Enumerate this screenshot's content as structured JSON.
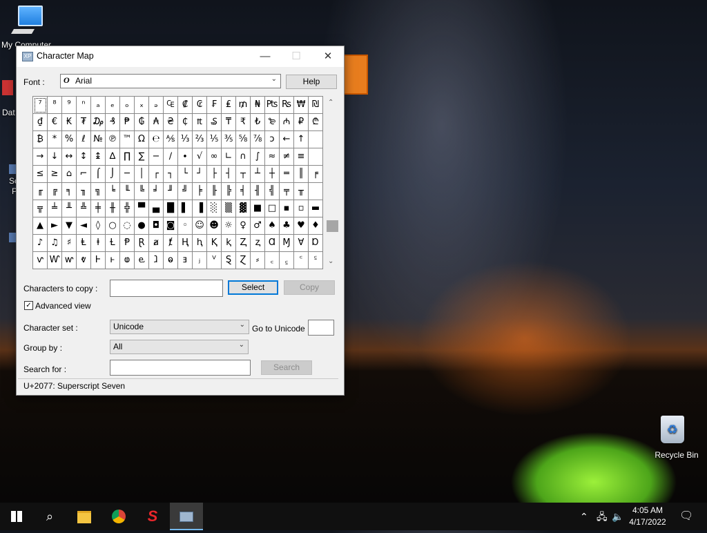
{
  "desktop": {
    "icons": [
      {
        "label": "My Computer"
      },
      {
        "label": "Dat"
      },
      {
        "label": "Sc"
      },
      {
        "label": "P"
      },
      {
        "label": "Recycle Bin"
      }
    ]
  },
  "window": {
    "title": "Character Map",
    "title_icon": "XP",
    "controls": {
      "minimize": "—",
      "maximize": "☐",
      "close": "✕"
    },
    "font_label": "Font :",
    "font_value": "Arial",
    "font_prefix_icon": "O",
    "help_label": "Help",
    "characters": [
      [
        "⁷",
        "⁸",
        "⁹",
        "ⁿ",
        "ₐ",
        "ₑ",
        "ₒ",
        "ₓ",
        "ₔ",
        "₠",
        "₡",
        "₢",
        "₣",
        "₤",
        "₥",
        "₦",
        "₧",
        "₨",
        "₩",
        "₪"
      ],
      [
        "₫",
        "€",
        "₭",
        "₮",
        "₯",
        "₰",
        "₱",
        "₲",
        "₳",
        "₴",
        "₵",
        "₶",
        "₷",
        "₸",
        "₹",
        "₺",
        "₻",
        "₼",
        "₽",
        "₾"
      ],
      [
        "₿",
        "*",
        "%",
        "ℓ",
        "№",
        "℗",
        "™",
        "Ω",
        "℮",
        "⅍",
        "⅓",
        "⅔",
        "⅕",
        "⅗",
        "⅝",
        "⅞",
        "ↄ",
        "←",
        "↑",
        ""
      ],
      [
        "→",
        "↓",
        "↔",
        "↕",
        "↨",
        "∆",
        "∏",
        "∑",
        "−",
        "∕",
        "∙",
        "√",
        "∞",
        "∟",
        "∩",
        "∫",
        "≈",
        "≠",
        "≡",
        ""
      ],
      [
        "≤",
        "≥",
        "⌂",
        "⌐",
        "⌠",
        "⌡",
        "─",
        "│",
        "┌",
        "┐",
        "└",
        "┘",
        "├",
        "┤",
        "┬",
        "┴",
        "┼",
        "═",
        "║",
        "╒"
      ],
      [
        "╓",
        "╔",
        "╕",
        "╖",
        "╗",
        "╘",
        "╙",
        "╚",
        "╛",
        "╜",
        "╝",
        "╞",
        "╟",
        "╠",
        "╡",
        "╢",
        "╣",
        "╤",
        "╥",
        ""
      ],
      [
        "╦",
        "╧",
        "╨",
        "╩",
        "╪",
        "╫",
        "╬",
        "▀",
        "▄",
        "█",
        "▌",
        "▐",
        "░",
        "▒",
        "▓",
        "■",
        "□",
        "▪",
        "▫",
        "▬"
      ],
      [
        "▲",
        "►",
        "▼",
        "◄",
        "◊",
        "○",
        "◌",
        "●",
        "◘",
        "◙",
        "◦",
        "☺",
        "☻",
        "☼",
        "♀",
        "♂",
        "♠",
        "♣",
        "♥",
        "♦"
      ],
      [
        "♪",
        "♫",
        "♯",
        "Ⱡ",
        "ⱡ",
        "Ɫ",
        "Ᵽ",
        "Ɽ",
        "ⱥ",
        "ⱦ",
        "Ⱨ",
        "ⱨ",
        "Ⱪ",
        "ⱪ",
        "Ⱬ",
        "ⱬ",
        "Ɑ",
        "Ɱ",
        "Ɐ",
        "Ɒ"
      ],
      [
        "ⱱ",
        "Ⱳ",
        "ⱳ",
        "ⱴ",
        "Ⱶ",
        "ⱶ",
        "ⱷ",
        "ⱸ",
        "ⱹ",
        "ⱺ",
        "ⱻ",
        "ⱼ",
        "ⱽ",
        "Ȿ",
        "Ɀ",
        "⸗",
        "꜀",
        "꜁",
        "꜂",
        "꜃"
      ]
    ],
    "characters_to_copy_label": "Characters to copy :",
    "characters_to_copy_value": "",
    "select_label": "Select",
    "copy_label": "Copy",
    "advanced_view_label": "Advanced view",
    "advanced_view_checked": true,
    "character_set_label": "Character set :",
    "character_set_value": "Unicode",
    "go_to_unicode_label": "Go to Unicode :",
    "go_to_unicode_value": "",
    "group_by_label": "Group by :",
    "group_by_value": "All",
    "search_for_label": "Search for :",
    "search_for_value": "",
    "search_label": "Search",
    "status": "U+2077: Superscript Seven"
  },
  "taskbar": {
    "time": "4:05 AM",
    "date": "4/17/2022",
    "icons": [
      "windows-start-icon",
      "search-icon",
      "file-explorer-icon",
      "chrome-icon",
      "s-app-icon",
      "charmap-icon"
    ]
  }
}
